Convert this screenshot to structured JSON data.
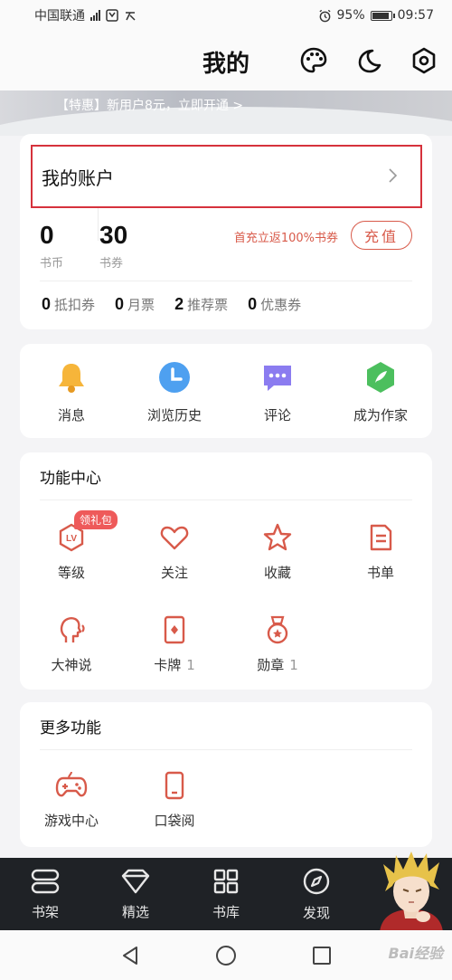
{
  "status": {
    "carrier": "中国联通",
    "battery": "95%",
    "battery_level": 0.95,
    "time": "09:57"
  },
  "header": {
    "title": "我的",
    "icons": [
      "palette-icon",
      "moon-icon",
      "settings-hex-icon"
    ]
  },
  "banner": {
    "text": "【特惠】新用户8元，立即开通 >"
  },
  "account": {
    "title": "我的账户",
    "coins": {
      "value": "0",
      "label": "书币"
    },
    "vouchers": {
      "value": "30",
      "label": "书券"
    },
    "promo": "首充立返100%书券",
    "recharge_label": "充值",
    "coupons": [
      {
        "count": "0",
        "label": "抵扣券"
      },
      {
        "count": "0",
        "label": "月票"
      },
      {
        "count": "2",
        "label": "推荐票"
      },
      {
        "count": "0",
        "label": "优惠券"
      }
    ]
  },
  "quick": [
    {
      "label": "消息",
      "icon": "bell-icon"
    },
    {
      "label": "浏览历史",
      "icon": "clock-icon"
    },
    {
      "label": "评论",
      "icon": "chat-icon"
    },
    {
      "label": "成为作家",
      "icon": "quill-icon"
    }
  ],
  "function_center": {
    "title": "功能中心",
    "gift_badge": "领礼包",
    "items": [
      {
        "label": "等级",
        "count": "",
        "icon": "level-icon"
      },
      {
        "label": "关注",
        "count": "",
        "icon": "heart-icon"
      },
      {
        "label": "收藏",
        "count": "",
        "icon": "star-icon"
      },
      {
        "label": "书单",
        "count": "",
        "icon": "booklist-icon"
      },
      {
        "label": "大神说",
        "count": "",
        "icon": "head-speak-icon"
      },
      {
        "label": "卡牌",
        "count": "1",
        "icon": "card-icon"
      },
      {
        "label": "勋章",
        "count": "1",
        "icon": "medal-icon"
      }
    ]
  },
  "more": {
    "title": "更多功能",
    "items": [
      {
        "label": "游戏中心",
        "icon": "gamepad-icon"
      },
      {
        "label": "口袋阅",
        "icon": "phone-icon"
      }
    ]
  },
  "bottom_nav": [
    {
      "label": "书架",
      "icon": "bookshelf-icon"
    },
    {
      "label": "精选",
      "icon": "diamond-icon"
    },
    {
      "label": "书库",
      "icon": "grid-icon"
    },
    {
      "label": "发现",
      "icon": "compass-icon"
    }
  ],
  "colors": {
    "accent": "#d85a4a",
    "highlight_border": "#d6323c",
    "nav_bg": "#1f2226"
  },
  "watermark": "Bai经验"
}
